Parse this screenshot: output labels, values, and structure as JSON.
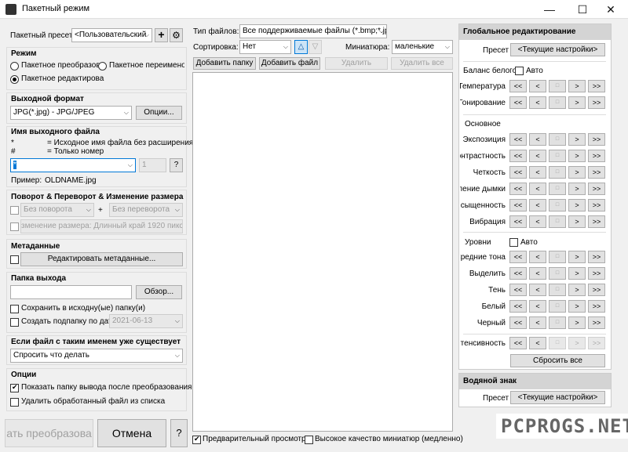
{
  "window": {
    "title": "Пакетный режим",
    "minimize": "—",
    "maximize": "☐",
    "close": "✕"
  },
  "left": {
    "preset_label": "Пакетный пресет",
    "preset_value": "<Пользовательский",
    "add_icon": "+",
    "settings_icon": "⚙",
    "mode_title": "Режим",
    "mode_convert": "Пакетное преобразова",
    "mode_rename": "Пакетное переимено",
    "mode_edit": "Пакетное редактирова",
    "format_title": "Выходной формат",
    "format_value": "JPG(*.jpg) - JPG/JPEG",
    "options_button": "Опции...",
    "filename_title": "Имя выходного файла",
    "star_sym": "*",
    "star_desc": "= Исходное имя файла без расширения",
    "hash_sym": "#",
    "hash_desc": "= Только номер",
    "filename_value": "*",
    "start_number": "1",
    "help_button": "?",
    "example_label": "Пример:",
    "example_value": "OLDNAME.jpg",
    "rotate_title": "Поворот & Переворот & Изменение размера",
    "rotate_value": "Без поворота",
    "plus": "+",
    "flip_value": "Без переворота",
    "resize_value": "зменение размера: Длинный край 1920 пиксел",
    "meta_title": "Метаданные",
    "meta_button": "Редактировать метаданные...",
    "outdir_title": "Папка выхода",
    "outdir_value": "",
    "browse_button": "Обзор...",
    "save_source": "Сохранить в исходну(ые) папку(и)",
    "create_sub": "Создать подпапку по дате",
    "date_value": "2021-06-13",
    "exists_title": "Если файл с таким именем уже существует",
    "exists_value": "Спросить что делать",
    "opts_title": "Опции",
    "opt_show": "Показать папку вывода после преобразования",
    "opt_remove": "Удалить обработанный файл из списка",
    "start_button": "ать преобразова",
    "cancel_button": "Отмена",
    "q_button": "?"
  },
  "middle": {
    "filetype_label": "Тип файлов:",
    "filetype_value": "Все поддерживаемые файлы (*.bmp;*.jp",
    "sort_label": "Сортировка:",
    "sort_value": "Нет",
    "sort_up": "△",
    "sort_down": "▽",
    "thumb_label": "Миниатюра:",
    "thumb_value": "маленькие",
    "add_folder": "Добавить папку",
    "add_file": "Добавить файл",
    "remove": "Удалить",
    "remove_all": "Удалить все",
    "preview": "Предварительный просмотр",
    "hq": "Высокое качество миниатюр (медленно)"
  },
  "right": {
    "header": "Глобальное редактирование",
    "preset_label": "Пресет",
    "preset_btn": "<Текущие настройки>",
    "wb_label": "Баланс белого",
    "auto": "Авто",
    "rows_a": [
      {
        "label": "Температура"
      },
      {
        "label": "Гонирование"
      }
    ],
    "basic": "Основное",
    "rows_b": [
      {
        "label": "Экспозиция"
      },
      {
        "label": "онтрастность"
      },
      {
        "label": "Четкость"
      },
      {
        "label": "ление дымки"
      },
      {
        "label": "сыщенность"
      },
      {
        "label": "Вибрация"
      }
    ],
    "levels": "Уровни",
    "levels_auto": "Авто",
    "rows_c": [
      {
        "label": "Средние тона"
      },
      {
        "label": "Выделить"
      },
      {
        "label": "Тень"
      },
      {
        "label": "Белый"
      },
      {
        "label": "Черный"
      }
    ],
    "intensity": "итенсивность",
    "arrows": {
      "ll": "<<",
      "l": "<",
      "m": "□",
      "r": ">",
      "rr": ">>"
    },
    "reset": "Сбросить все",
    "wm_header": "Водяной знак",
    "wm_preset_label": "Пресет",
    "wm_preset_btn": "<Текущие настройки>"
  },
  "watermark": "PCPROGS.NET"
}
